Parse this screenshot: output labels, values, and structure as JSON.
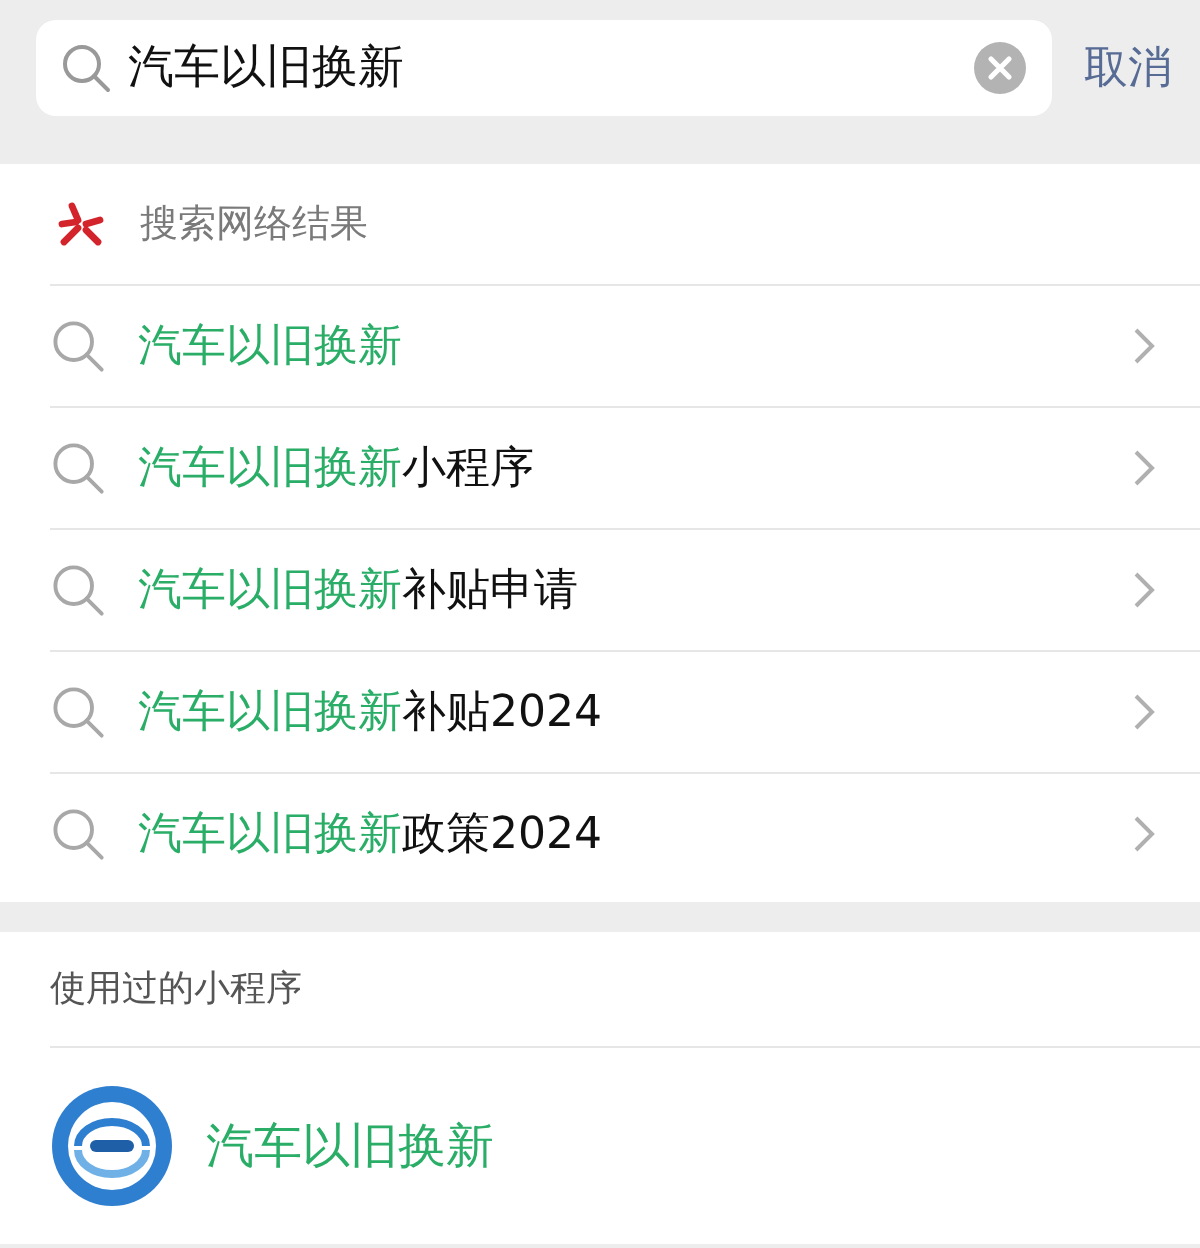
{
  "search": {
    "value": "汽车以旧换新",
    "cancel": "取消"
  },
  "web_results": {
    "title": "搜索网络结果",
    "suggestions": [
      {
        "match": "汽车以旧换新"
      },
      {
        "match": "汽车以旧换新",
        "rest": "小程序"
      },
      {
        "match": "汽车以旧换新",
        "rest": "补贴申请"
      },
      {
        "match": "汽车以旧换新",
        "rest": "补贴2024"
      },
      {
        "match": "汽车以旧换新",
        "rest": "政策2024"
      }
    ]
  },
  "mini_programs": {
    "title": "使用过的小程序",
    "items": [
      {
        "name": "汽车以旧换新"
      }
    ]
  }
}
